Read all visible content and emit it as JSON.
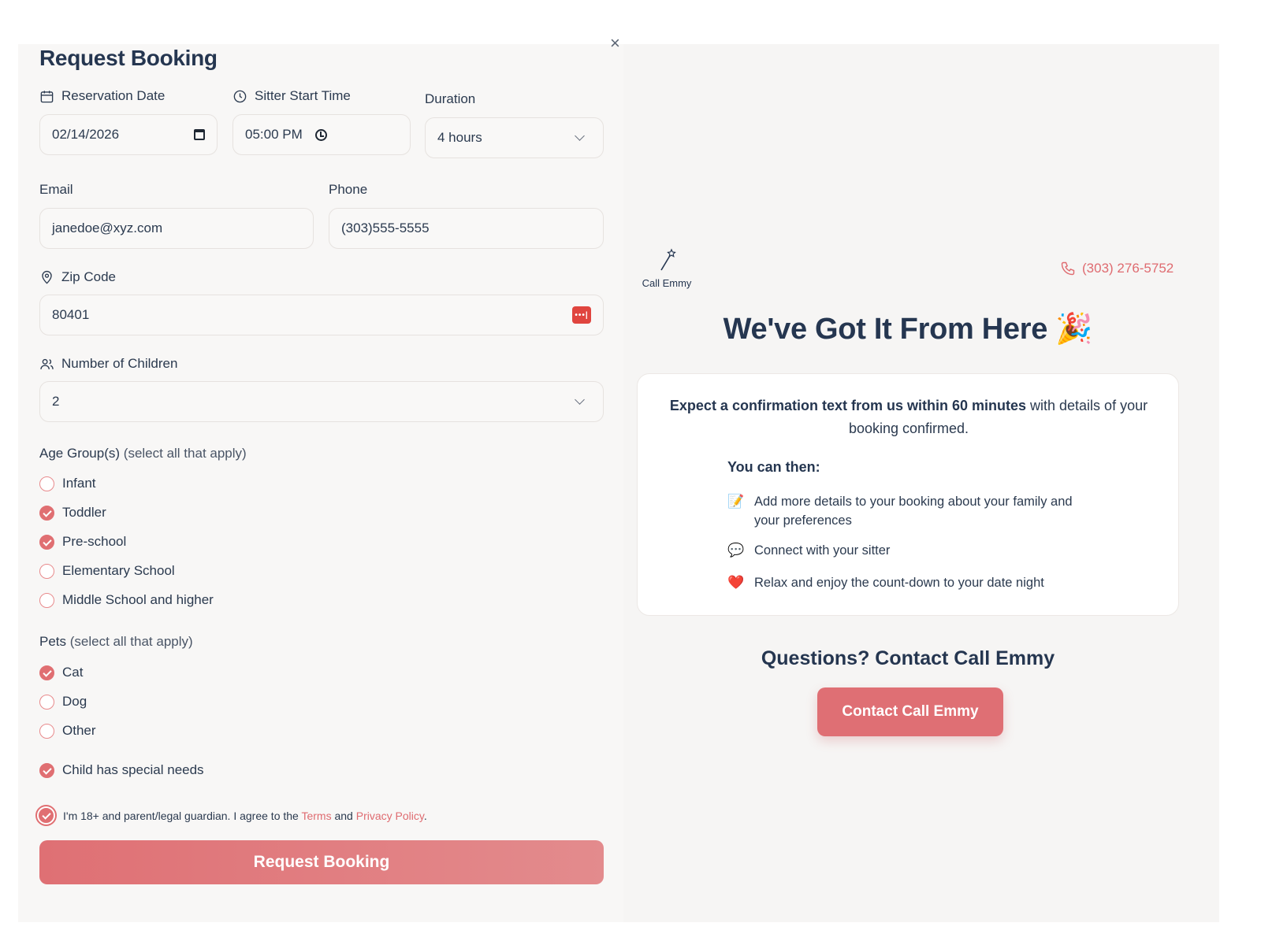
{
  "form": {
    "title": "Request Booking",
    "close_icon": "×",
    "reservation_date": {
      "label": "Reservation Date",
      "value": "02/14/2026"
    },
    "start_time": {
      "label": "Sitter Start Time",
      "value": "05:00 PM"
    },
    "duration": {
      "label": "Duration",
      "value": "4 hours"
    },
    "email": {
      "label": "Email",
      "value": "janedoe@xyz.com"
    },
    "phone": {
      "label": "Phone",
      "value": "(303)555-5555"
    },
    "zip": {
      "label": "Zip Code",
      "value": "80401",
      "autofill_icon": "•••|"
    },
    "children": {
      "label": "Number of Children",
      "value": "2"
    },
    "age_groups": {
      "label": "Age Group(s)",
      "hint": "(select all that apply)",
      "options": [
        {
          "label": "Infant",
          "checked": false
        },
        {
          "label": "Toddler",
          "checked": true
        },
        {
          "label": "Pre-school",
          "checked": true
        },
        {
          "label": "Elementary School",
          "checked": false
        },
        {
          "label": "Middle School and higher",
          "checked": false
        }
      ]
    },
    "pets": {
      "label": "Pets",
      "hint": "(select all that apply)",
      "options": [
        {
          "label": "Cat",
          "checked": true
        },
        {
          "label": "Dog",
          "checked": false
        },
        {
          "label": "Other",
          "checked": false
        }
      ]
    },
    "special_needs": {
      "label": "Child has special needs",
      "checked": true
    },
    "agreement": {
      "prefix": "I'm 18+ and parent/legal guardian. I agree to the",
      "terms": "Terms",
      "and": "and",
      "privacy": "Privacy Policy",
      "suffix": ".",
      "checked": true
    },
    "submit_label": "Request Booking"
  },
  "confirmation": {
    "brand_name": "Call Emmy",
    "phone": "(303) 276-5752",
    "title": "We've Got It From Here",
    "title_emoji": "🎉",
    "intro_bold": "Expect a confirmation text from us within 60 minutes",
    "intro_rest": "with details of your booking confirmed.",
    "subheading": "You can then:",
    "steps": [
      {
        "emoji": "📝",
        "text": "Add more details to your booking about your family and your preferences"
      },
      {
        "emoji": "💬",
        "text": "Connect with your sitter"
      },
      {
        "emoji": "❤️",
        "text": "Relax and enjoy the count-down to your date night"
      }
    ],
    "contact_heading": "Questions? Contact Call Emmy",
    "contact_button": "Contact Call Emmy"
  },
  "colors": {
    "accent": "#df6f74",
    "heading": "#253650",
    "text": "#2b3a4f",
    "panel_left": "#f8f7f6",
    "panel_right": "#f6f5f4"
  }
}
